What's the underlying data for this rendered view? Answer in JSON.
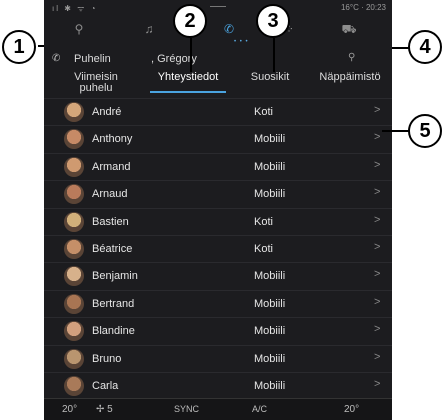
{
  "status": {
    "left": "ıl ✱ ᯤ ◔",
    "right": "16°C · 20:23"
  },
  "header": {
    "title": "Puhelin",
    "contact": ", Grégory"
  },
  "tabs": [
    {
      "label": "Viimeisin\npuhelu"
    },
    {
      "label": "Yhteystiedot"
    },
    {
      "label": "Suosikit"
    },
    {
      "label": "Näppäimistö"
    }
  ],
  "contacts": [
    {
      "name": "André",
      "type": "Koti",
      "color": "#d4a67a"
    },
    {
      "name": "Anthony",
      "type": "Mobiili",
      "color": "#c68a66"
    },
    {
      "name": "Armand",
      "type": "Mobiili",
      "color": "#cf9a70"
    },
    {
      "name": "Arnaud",
      "type": "Mobiili",
      "color": "#b97b5b"
    },
    {
      "name": "Bastien",
      "type": "Koti",
      "color": "#d2b07a"
    },
    {
      "name": "Béatrice",
      "type": "Koti",
      "color": "#c58f68"
    },
    {
      "name": "Benjamin",
      "type": "Mobiili",
      "color": "#d7b18b"
    },
    {
      "name": "Bertrand",
      "type": "Mobiili",
      "color": "#a87553"
    },
    {
      "name": "Blandine",
      "type": "Mobiili",
      "color": "#d2a07e"
    },
    {
      "name": "Bruno",
      "type": "Mobiili",
      "color": "#b9956f"
    },
    {
      "name": "Carla",
      "type": "Mobiili",
      "color": "#a97a59"
    }
  ],
  "bottom": {
    "left_temp": "20°",
    "fan": "5",
    "sync": "SYNC",
    "ac": "A/C",
    "right_temp": "20°"
  },
  "callouts": [
    "1",
    "2",
    "3",
    "4",
    "5"
  ],
  "accent": "#4aa3df"
}
